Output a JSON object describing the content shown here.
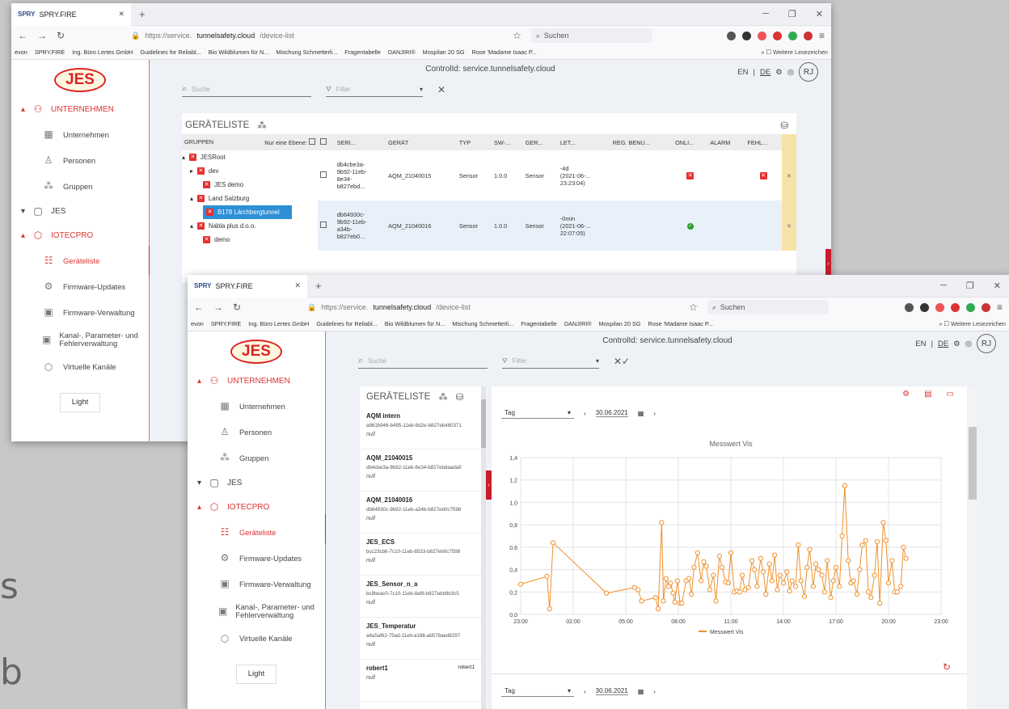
{
  "browser": {
    "tab_title": "SPRY.FIRE",
    "tab_logo": "SPRY",
    "url_prefix": "https://service.",
    "url_domain": "tunnelsafety.cloud",
    "url_path": "/device-list",
    "search_placeholder": "Suchen",
    "bookmarks": [
      "evon",
      "SPRY.FIRE",
      "Ing. Büro Lertes GmbH",
      "Guidelines for Reliabl...",
      "Bio Wildblumen für N...",
      "Mischung Schmetterli...",
      "Fragentabelle",
      "DANJIRI®",
      "Mospilan 20 SG",
      "Rose 'Madame Isaac P..."
    ],
    "more_bookmarks": "Weitere Lesezeichen"
  },
  "app": {
    "header": "ControlId: service.tunnelsafety.cloud",
    "lang_en": "EN",
    "lang_de": "DE",
    "user_initials": "RJ",
    "search_placeholder": "Suche",
    "filter_placeholder": "Filter",
    "logo": "JES",
    "sidebar": {
      "unternehmen": "UNTERNEHMEN",
      "items_company": [
        "Unternehmen",
        "Personen",
        "Gruppen"
      ],
      "jes": "JES",
      "iotecpro": "IOTECPRO",
      "items_iot": [
        "Geräteliste",
        "Firmware-Updates",
        "Firmware-Verwaltung",
        "Kanal-, Parameter- und Fehlerverwaltung",
        "Virtuelle Kanäle"
      ],
      "light": "Light"
    }
  },
  "win1": {
    "panel_title": "GERÄTELISTE",
    "groups_header": "GRUPPEN",
    "only_one_level": "Nur eine Ebene:",
    "tree": [
      "JESRoot",
      "dev",
      "JES demo",
      "Land Salzburg",
      "B178 Lärchbergtunnel",
      "Nabla plus d.o.o.",
      "demo"
    ],
    "columns": [
      "SERI...",
      "GERÄT",
      "TYP",
      "SW-...",
      "GER...",
      "LET...",
      "REG. BENU...",
      "ONLI...",
      "ALARM",
      "FEHL..."
    ],
    "rows": [
      {
        "serial": [
          "db4cbe3a-",
          "9b92-11eb-",
          "8e34-",
          "b827ebd..."
        ],
        "device": "AQM_21040015",
        "type": "Sensor",
        "sw": "1.0.0",
        "ger": "Sensor",
        "last": [
          "-4d",
          "(2021-06-...",
          "23:23:04)"
        ]
      },
      {
        "serial": [
          "db64930c-",
          "9b92-11eb-",
          "a34b-",
          "b827eb0..."
        ],
        "device": "AQM_21040016",
        "type": "Sensor",
        "sw": "1.0.0",
        "ger": "Sensor",
        "last": [
          "-0min",
          "(2021-06-...",
          "22:07:05)"
        ]
      }
    ]
  },
  "win2": {
    "panel_title": "GERÄTELISTE",
    "devices": [
      {
        "name": "AQM intern",
        "id": "a861b946-b495-11eb-8d2e-b827eb460371",
        "note": "null"
      },
      {
        "name": "AQM_21040015",
        "id": "db4cbe3a-9b92-11eb-8e34-b827ebdaada9",
        "note": "null"
      },
      {
        "name": "AQM_21040016",
        "id": "db64930c-9b92-11eb-a34b-b827eb0c7598",
        "note": "null"
      },
      {
        "name": "JES_ECS",
        "id": "bcc23cb6-7c10-11eb-8533-b827eb0c7598",
        "note": "null"
      },
      {
        "name": "JES_Sensor_n_a",
        "id": "bc9beac0-7c10-11eb-8af8-b827ebb9b3c5",
        "note": "null"
      },
      {
        "name": "JES_Temperatur",
        "id": "a6a5af62-75ad-11eb-a186-ab578aed8297",
        "note": "null"
      },
      {
        "name": "robert1",
        "id": "",
        "note": "null",
        "right": "robert1"
      }
    ],
    "period": "Tag",
    "date": "30.06.2021"
  },
  "chart_data": {
    "type": "line",
    "title": "Messwert Vis",
    "series": [
      {
        "name": "Messwert Vis",
        "color": "#f0902a"
      }
    ],
    "xticks": [
      "23:00",
      "02:00",
      "05:00",
      "08:00",
      "11:00",
      "14:00",
      "17:00",
      "20:00",
      "23:00"
    ],
    "yticks": [
      "0,0",
      "0,2",
      "0,4",
      "0,6",
      "0,8",
      "1,0",
      "1,2",
      "1,4"
    ],
    "ylim": [
      0,
      1.4
    ],
    "x_hours": [
      0,
      1.5,
      1.65,
      1.85,
      4.9,
      6.5,
      6.7,
      6.9,
      7.7,
      7.85,
      8.05,
      8.15,
      8.3,
      8.45,
      8.55,
      8.7,
      8.8,
      8.95,
      9.1,
      9.2,
      9.45,
      9.6,
      9.75,
      9.9,
      10.1,
      10.3,
      10.45,
      10.6,
      10.8,
      11.0,
      11.15,
      11.35,
      11.5,
      11.7,
      11.85,
      12.0,
      12.2,
      12.35,
      12.5,
      12.65,
      12.8,
      13.0,
      13.2,
      13.35,
      13.5,
      13.7,
      13.85,
      14.0,
      14.2,
      14.35,
      14.5,
      14.65,
      14.8,
      15.0,
      15.2,
      15.35,
      15.5,
      15.7,
      15.85,
      16.0,
      16.2,
      16.35,
      16.5,
      16.7,
      16.85,
      17.0,
      17.2,
      17.35,
      17.5,
      17.7,
      17.85,
      18.0,
      18.2,
      18.35,
      18.5,
      18.7,
      18.85,
      19.0,
      19.2,
      19.35,
      19.5,
      19.7,
      19.85,
      20.0,
      20.2,
      20.35,
      20.5,
      20.7,
      20.85,
      21.0,
      21.2,
      21.35,
      21.5,
      21.7,
      21.85,
      22.0
    ],
    "values": [
      0.27,
      0.34,
      0.05,
      0.64,
      0.19,
      0.24,
      0.22,
      0.12,
      0.15,
      0.05,
      0.82,
      0.12,
      0.32,
      0.25,
      0.28,
      0.19,
      0.11,
      0.3,
      0.1,
      0.1,
      0.3,
      0.32,
      0.18,
      0.42,
      0.55,
      0.3,
      0.47,
      0.43,
      0.22,
      0.35,
      0.12,
      0.52,
      0.42,
      0.29,
      0.28,
      0.55,
      0.2,
      0.21,
      0.2,
      0.35,
      0.22,
      0.24,
      0.48,
      0.4,
      0.25,
      0.5,
      0.38,
      0.18,
      0.45,
      0.3,
      0.53,
      0.22,
      0.35,
      0.28,
      0.38,
      0.21,
      0.3,
      0.25,
      0.62,
      0.3,
      0.16,
      0.42,
      0.58,
      0.25,
      0.45,
      0.4,
      0.35,
      0.2,
      0.48,
      0.15,
      0.3,
      0.42,
      0.25,
      0.7,
      1.15,
      0.48,
      0.28,
      0.3,
      0.18,
      0.4,
      0.62,
      0.66,
      0.2,
      0.15,
      0.35,
      0.65,
      0.1,
      0.82,
      0.66,
      0.28,
      0.48,
      0.2,
      0.2,
      0.25,
      0.6,
      0.5,
      0.21
    ]
  }
}
